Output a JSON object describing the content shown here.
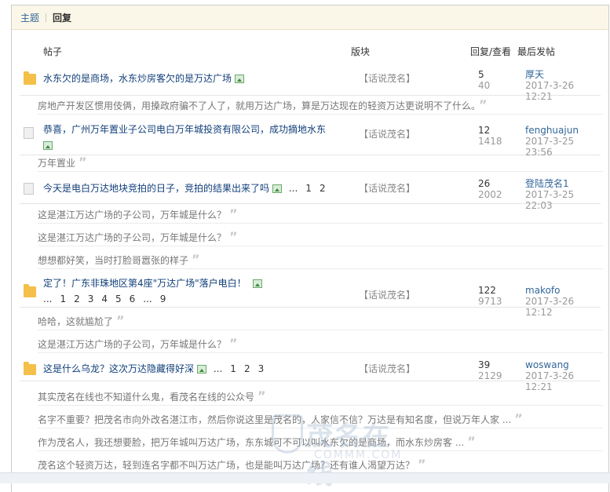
{
  "tabs": {
    "topics": "主题",
    "replies": "回复"
  },
  "columns": {
    "post": "帖子",
    "forum": "版块",
    "reply_view": "回复/查看",
    "last_post": "最后发帖"
  },
  "threads": [
    {
      "title": "水东欠的是商场，水东炒房客欠的是万达广场",
      "forum": "【话说茂名】",
      "replies": "5",
      "views": "40",
      "author": "厚天",
      "date": "2017-3-26 12:21",
      "icon": "hot-folder-icon",
      "snippets": [
        "房地产开发区惯用伎俩，用搡政府骗不了人了，就用万达广场，算是万达现在的轻资万达更说明不了什么。"
      ]
    },
    {
      "title": "恭喜，广州万年置业子公司电白万年城投资有限公司，成功摘地水东",
      "forum": "【话说茂名】",
      "replies": "12",
      "views": "1418",
      "author": "fenghuajun",
      "date": "2017-3-25 23:56",
      "icon": "document-icon",
      "snippets": [
        "万年置业"
      ]
    },
    {
      "title": "今天是电白万达地块竞拍的日子，竞拍的结果出来了吗",
      "pages": [
        "...",
        "1",
        "2"
      ],
      "forum": "【话说茂名】",
      "replies": "26",
      "views": "2002",
      "author": "登陆茂名1",
      "date": "2017-3-25 22:03",
      "icon": "document-icon",
      "snippets": [
        "这是湛江万达广场的子公司，万年城是什么？",
        "这是湛江万达广场的子公司，万年城是什么？",
        "想想都好笑，当时打脸哥嚣张的样子"
      ]
    },
    {
      "title": "定了！广东非珠地区第4座\"万达广场\"落户电白！",
      "pages": [
        "...",
        "1",
        "2",
        "3",
        "4",
        "5",
        "6",
        "...",
        "9"
      ],
      "forum": "【话说茂名】",
      "replies": "122",
      "views": "9713",
      "author": "makofo",
      "date": "2017-3-26 12:12",
      "icon": "hot-folder-icon",
      "snippets": [
        "哈哈，这就尴尬了",
        "这是湛江万达广场的子公司，万年城是什么？"
      ]
    },
    {
      "title": "这是什么乌龙？这次万达隐藏得好深",
      "pages": [
        "...",
        "1",
        "2",
        "3"
      ],
      "forum": "【话说茂名】",
      "replies": "39",
      "views": "2129",
      "author": "woswang",
      "date": "2017-3-26 12:21",
      "icon": "hot-folder-icon",
      "snippets": [
        "其实茂名在线也不知道什么鬼，看茂名在线的公众号",
        "名字不重要？把茂名市向外改名湛江市，然后你说这里是茂名的，人家信不信？万达是有知名度，但说万年人家 ...",
        "作为茂名人，我还想要脸，把万年城叫万达广场，东东城可不可以叫水东欠的是商场，而水东炒房客 ...",
        "茂名这个轻资万达，轻到连名字都不叫万达广场，也是能叫万达广场？还有谁人渴望万达？"
      ]
    }
  ],
  "watermark": {
    "text": "茂名在线",
    "url": "COMMM.COM"
  },
  "colors": {
    "link": "#113f7a",
    "accent_link": "#336699",
    "tab_bg": "#fbf7e8",
    "hot_folder": "#f4c04a"
  }
}
